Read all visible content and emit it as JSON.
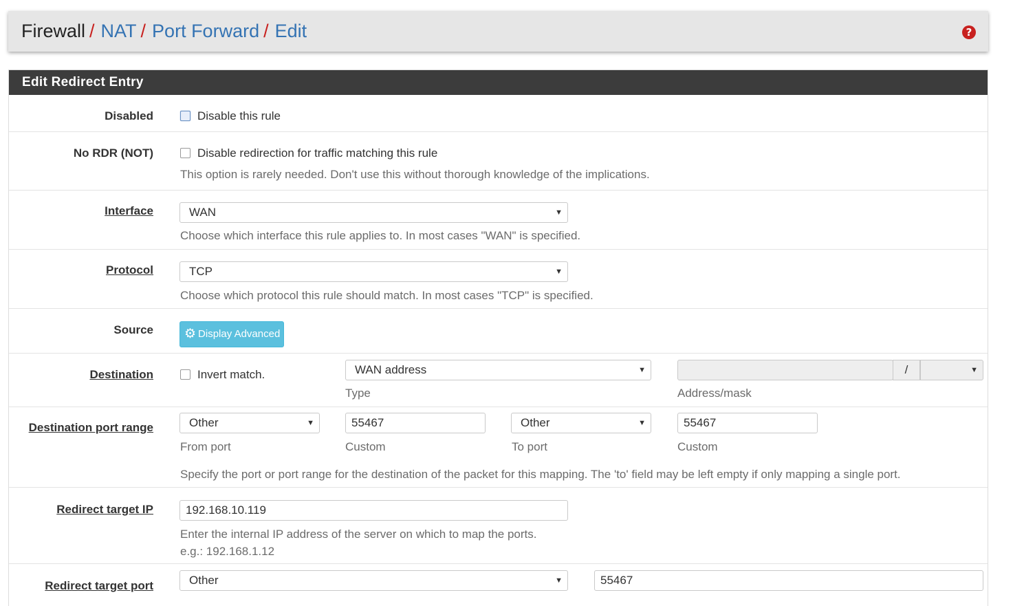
{
  "breadcrumb": {
    "items": [
      "Firewall",
      "NAT",
      "Port Forward",
      "Edit"
    ],
    "separator": "/"
  },
  "panel": {
    "title": "Edit Redirect Entry"
  },
  "disabled": {
    "label": "Disabled",
    "checkbox_text": "Disable this rule"
  },
  "nordr": {
    "label": "No RDR (NOT)",
    "checkbox_text": "Disable redirection for traffic matching this rule",
    "help": "This option is rarely needed. Don't use this without thorough knowledge of the implications."
  },
  "interface": {
    "label": "Interface",
    "value": "WAN",
    "help": "Choose which interface this rule applies to. In most cases \"WAN\" is specified."
  },
  "protocol": {
    "label": "Protocol",
    "value": "TCP",
    "help": "Choose which protocol this rule should match. In most cases \"TCP\" is specified."
  },
  "source": {
    "label": "Source",
    "button": "Display Advanced"
  },
  "destination": {
    "label": "Destination",
    "invert_text": "Invert match.",
    "type_value": "WAN address",
    "type_caption": "Type",
    "address_value": "",
    "mask_sep": "/",
    "mask_value": "",
    "address_caption": "Address/mask"
  },
  "dest_port": {
    "label": "Destination port range",
    "from_select": "Other",
    "from_caption": "From port",
    "from_custom": "55467",
    "from_custom_caption": "Custom",
    "to_select": "Other",
    "to_caption": "To port",
    "to_custom": "55467",
    "to_custom_caption": "Custom",
    "help": "Specify the port or port range for the destination of the packet for this mapping. The 'to' field may be left empty if only mapping a single port."
  },
  "redirect_ip": {
    "label": "Redirect target IP",
    "value": "192.168.10.119",
    "help": "Enter the internal IP address of the server on which to map the ports.",
    "example": "e.g.: 192.168.1.12"
  },
  "redirect_port": {
    "label": "Redirect target port",
    "select": "Other",
    "custom": "55467"
  },
  "colors": {
    "header_bg": "#3c3c3c",
    "link": "#3473b3",
    "separator": "#c8211f",
    "info_button": "#5bc0de"
  }
}
